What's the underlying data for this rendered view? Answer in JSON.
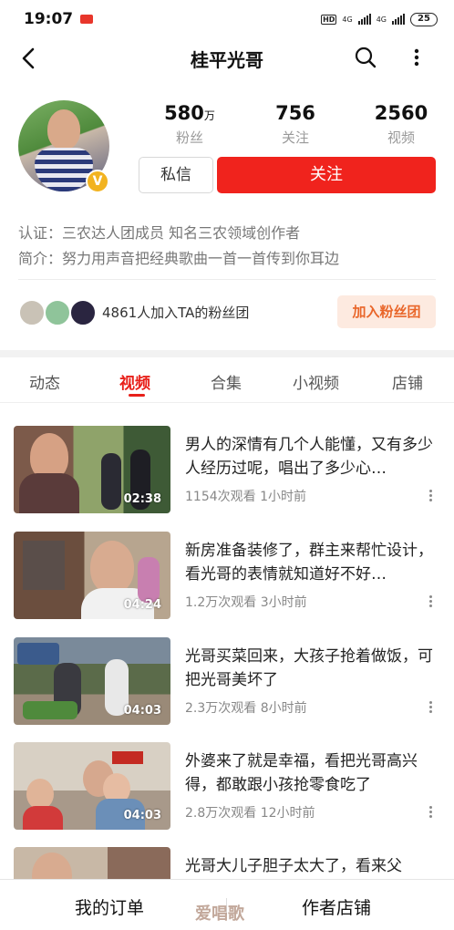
{
  "status_bar": {
    "time": "19:07",
    "app_badge": "头条",
    "network_1": "4G",
    "network_2": "4G",
    "hd": "HD",
    "battery": "25"
  },
  "nav": {
    "title": "桂平光哥",
    "icons": [
      "back-arrow-icon",
      "search-icon",
      "more-vertical-icon"
    ]
  },
  "profile": {
    "stats": [
      {
        "value": "580",
        "unit": "万",
        "label": "粉丝"
      },
      {
        "value": "756",
        "unit": "",
        "label": "关注"
      },
      {
        "value": "2560",
        "unit": "",
        "label": "视频"
      }
    ],
    "message_button": "私信",
    "follow_button": "关注",
    "certification": "认证：三农达人团成员 知名三农领域创作者",
    "bio": "简介：努力用声音把经典歌曲一首一首传到你耳边",
    "verified_badge": "V"
  },
  "fan_group": {
    "text": "4861人加入TA的粉丝团",
    "join_button": "加入粉丝团"
  },
  "tabs": [
    {
      "label": "动态",
      "active": false
    },
    {
      "label": "视频",
      "active": true
    },
    {
      "label": "合集",
      "active": false
    },
    {
      "label": "小视频",
      "active": false
    },
    {
      "label": "店铺",
      "active": false
    }
  ],
  "videos": [
    {
      "title": "男人的深情有几个人能懂，又有多少人经历过呢，唱出了多少心…",
      "duration": "02:38",
      "views": "1154次观看",
      "time": "1小时前"
    },
    {
      "title": "新房准备装修了，群主来帮忙设计，看光哥的表情就知道好不好…",
      "duration": "04:24",
      "views": "1.2万次观看",
      "time": "3小时前"
    },
    {
      "title": "光哥买菜回来，大孩子抢着做饭，可把光哥美坏了",
      "duration": "04:03",
      "views": "2.3万次观看",
      "time": "8小时前"
    },
    {
      "title": "外婆来了就是幸福，看把光哥高兴得，都敢跟小孩抢零食吃了",
      "duration": "04:03",
      "views": "2.8万次观看",
      "time": "12小时前"
    },
    {
      "title": "光哥大儿子胆子太大了，看来父",
      "duration": "",
      "views": "",
      "time": ""
    }
  ],
  "bottom_bar": {
    "orders": "我的订单",
    "shop": "作者店铺"
  },
  "watermark": "爱唱歌",
  "colors": {
    "accent_red": "#f0231d",
    "fan_join_bg": "#fdeae0",
    "fan_join_text": "#e9662a",
    "badge_gold": "#f2b320"
  }
}
